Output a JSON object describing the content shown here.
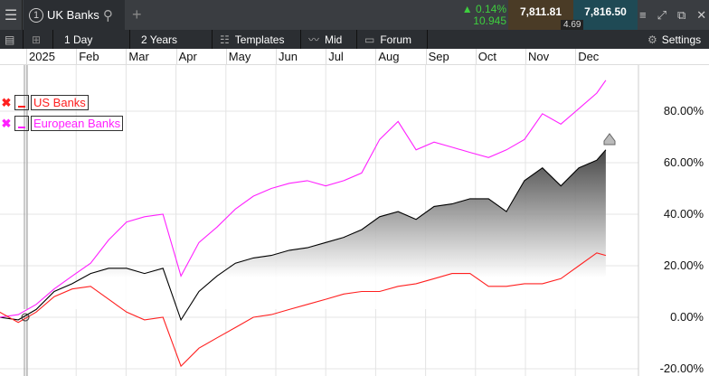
{
  "tab": {
    "number": "1",
    "title": "UK Banks"
  },
  "quote": {
    "change_pct": "0.14%",
    "change": "10.945",
    "bid": "7,811.81",
    "ask": "7,816.50",
    "spread": "4.69"
  },
  "toolbar": {
    "interval": "1 Day",
    "range": "2 Years",
    "templates": "Templates",
    "price_type": "Mid",
    "forum": "Forum",
    "settings": "Settings"
  },
  "colors": {
    "up": "#3ecf3e",
    "bid_bg": "#4a3b26",
    "ask_bg": "#1f4a55",
    "us": "#ff2020",
    "eu": "#ff20ff"
  },
  "legend": [
    {
      "name": "US Banks",
      "color": "#ff2020"
    },
    {
      "name": "European Banks",
      "color": "#ff20ff"
    }
  ],
  "chart_data": {
    "type": "line",
    "x_months": [
      "2025",
      "Feb",
      "Mar",
      "Apr",
      "May",
      "Jun",
      "Jul",
      "Aug",
      "Sep",
      "Oct",
      "Nov",
      "Dec"
    ],
    "yticks": [
      "80.00%",
      "60.00%",
      "40.00%",
      "20.00%",
      "0.00%",
      "-20.00%"
    ],
    "ylim": [
      -22,
      100
    ],
    "x": [
      -0.53,
      -0.16,
      0.2,
      0.56,
      0.92,
      1.29,
      1.65,
      2.01,
      2.37,
      2.74,
      3.1,
      3.46,
      3.82,
      4.19,
      4.55,
      4.91,
      5.27,
      5.63,
      6.0,
      6.36,
      6.72,
      7.08,
      7.45,
      7.81,
      8.17,
      8.53,
      8.89,
      9.26,
      9.62,
      9.98,
      10.34,
      10.71,
      11.07,
      11.43,
      11.61
    ],
    "series": [
      {
        "name": "UK Banks",
        "color": "#000000",
        "values": [
          0,
          -1,
          3,
          10,
          13,
          17,
          19,
          19,
          17,
          19,
          -1,
          10,
          16,
          21,
          23,
          24,
          26,
          27,
          29,
          31,
          34,
          39,
          41,
          38,
          43,
          44,
          46,
          46,
          41,
          53,
          58,
          51,
          58,
          61,
          65
        ]
      },
      {
        "name": "European Banks",
        "color": "#ff20ff",
        "values": [
          0,
          1,
          5,
          11,
          16,
          21,
          30,
          37,
          39,
          40,
          16,
          29,
          35,
          42,
          47,
          50,
          52,
          53,
          51,
          53,
          56,
          69,
          76,
          65,
          68,
          66,
          64,
          62,
          65,
          69,
          79,
          75,
          81,
          87,
          92
        ]
      },
      {
        "name": "US Banks",
        "color": "#ff2020",
        "values": [
          2,
          -2,
          2,
          8,
          11,
          12,
          7,
          2,
          -1,
          0,
          -19,
          -12,
          -8,
          -4,
          0,
          1,
          3,
          5,
          7,
          9,
          10,
          10,
          12,
          13,
          15,
          17,
          17,
          12,
          12,
          13,
          13,
          15,
          20,
          25,
          24
        ]
      }
    ]
  }
}
